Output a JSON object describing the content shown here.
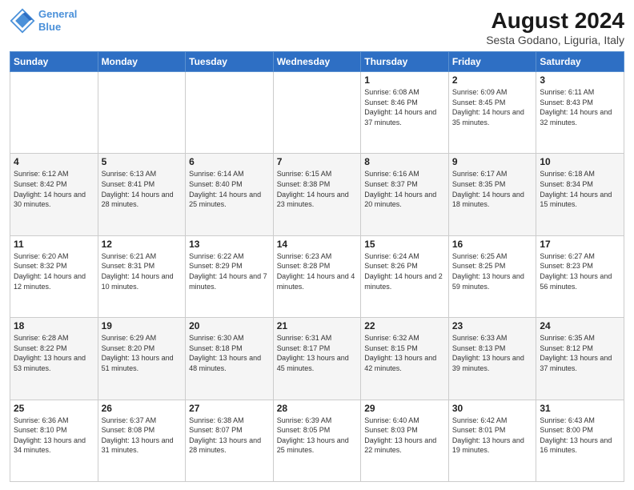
{
  "logo": {
    "line1": "General",
    "line2": "Blue"
  },
  "title": "August 2024",
  "subtitle": "Sesta Godano, Liguria, Italy",
  "days_of_week": [
    "Sunday",
    "Monday",
    "Tuesday",
    "Wednesday",
    "Thursday",
    "Friday",
    "Saturday"
  ],
  "weeks": [
    [
      {
        "day": "",
        "info": ""
      },
      {
        "day": "",
        "info": ""
      },
      {
        "day": "",
        "info": ""
      },
      {
        "day": "",
        "info": ""
      },
      {
        "day": "1",
        "info": "Sunrise: 6:08 AM\nSunset: 8:46 PM\nDaylight: 14 hours\nand 37 minutes."
      },
      {
        "day": "2",
        "info": "Sunrise: 6:09 AM\nSunset: 8:45 PM\nDaylight: 14 hours\nand 35 minutes."
      },
      {
        "day": "3",
        "info": "Sunrise: 6:11 AM\nSunset: 8:43 PM\nDaylight: 14 hours\nand 32 minutes."
      }
    ],
    [
      {
        "day": "4",
        "info": "Sunrise: 6:12 AM\nSunset: 8:42 PM\nDaylight: 14 hours\nand 30 minutes."
      },
      {
        "day": "5",
        "info": "Sunrise: 6:13 AM\nSunset: 8:41 PM\nDaylight: 14 hours\nand 28 minutes."
      },
      {
        "day": "6",
        "info": "Sunrise: 6:14 AM\nSunset: 8:40 PM\nDaylight: 14 hours\nand 25 minutes."
      },
      {
        "day": "7",
        "info": "Sunrise: 6:15 AM\nSunset: 8:38 PM\nDaylight: 14 hours\nand 23 minutes."
      },
      {
        "day": "8",
        "info": "Sunrise: 6:16 AM\nSunset: 8:37 PM\nDaylight: 14 hours\nand 20 minutes."
      },
      {
        "day": "9",
        "info": "Sunrise: 6:17 AM\nSunset: 8:35 PM\nDaylight: 14 hours\nand 18 minutes."
      },
      {
        "day": "10",
        "info": "Sunrise: 6:18 AM\nSunset: 8:34 PM\nDaylight: 14 hours\nand 15 minutes."
      }
    ],
    [
      {
        "day": "11",
        "info": "Sunrise: 6:20 AM\nSunset: 8:32 PM\nDaylight: 14 hours\nand 12 minutes."
      },
      {
        "day": "12",
        "info": "Sunrise: 6:21 AM\nSunset: 8:31 PM\nDaylight: 14 hours\nand 10 minutes."
      },
      {
        "day": "13",
        "info": "Sunrise: 6:22 AM\nSunset: 8:29 PM\nDaylight: 14 hours\nand 7 minutes."
      },
      {
        "day": "14",
        "info": "Sunrise: 6:23 AM\nSunset: 8:28 PM\nDaylight: 14 hours\nand 4 minutes."
      },
      {
        "day": "15",
        "info": "Sunrise: 6:24 AM\nSunset: 8:26 PM\nDaylight: 14 hours\nand 2 minutes."
      },
      {
        "day": "16",
        "info": "Sunrise: 6:25 AM\nSunset: 8:25 PM\nDaylight: 13 hours\nand 59 minutes."
      },
      {
        "day": "17",
        "info": "Sunrise: 6:27 AM\nSunset: 8:23 PM\nDaylight: 13 hours\nand 56 minutes."
      }
    ],
    [
      {
        "day": "18",
        "info": "Sunrise: 6:28 AM\nSunset: 8:22 PM\nDaylight: 13 hours\nand 53 minutes."
      },
      {
        "day": "19",
        "info": "Sunrise: 6:29 AM\nSunset: 8:20 PM\nDaylight: 13 hours\nand 51 minutes."
      },
      {
        "day": "20",
        "info": "Sunrise: 6:30 AM\nSunset: 8:18 PM\nDaylight: 13 hours\nand 48 minutes."
      },
      {
        "day": "21",
        "info": "Sunrise: 6:31 AM\nSunset: 8:17 PM\nDaylight: 13 hours\nand 45 minutes."
      },
      {
        "day": "22",
        "info": "Sunrise: 6:32 AM\nSunset: 8:15 PM\nDaylight: 13 hours\nand 42 minutes."
      },
      {
        "day": "23",
        "info": "Sunrise: 6:33 AM\nSunset: 8:13 PM\nDaylight: 13 hours\nand 39 minutes."
      },
      {
        "day": "24",
        "info": "Sunrise: 6:35 AM\nSunset: 8:12 PM\nDaylight: 13 hours\nand 37 minutes."
      }
    ],
    [
      {
        "day": "25",
        "info": "Sunrise: 6:36 AM\nSunset: 8:10 PM\nDaylight: 13 hours\nand 34 minutes."
      },
      {
        "day": "26",
        "info": "Sunrise: 6:37 AM\nSunset: 8:08 PM\nDaylight: 13 hours\nand 31 minutes."
      },
      {
        "day": "27",
        "info": "Sunrise: 6:38 AM\nSunset: 8:07 PM\nDaylight: 13 hours\nand 28 minutes."
      },
      {
        "day": "28",
        "info": "Sunrise: 6:39 AM\nSunset: 8:05 PM\nDaylight: 13 hours\nand 25 minutes."
      },
      {
        "day": "29",
        "info": "Sunrise: 6:40 AM\nSunset: 8:03 PM\nDaylight: 13 hours\nand 22 minutes."
      },
      {
        "day": "30",
        "info": "Sunrise: 6:42 AM\nSunset: 8:01 PM\nDaylight: 13 hours\nand 19 minutes."
      },
      {
        "day": "31",
        "info": "Sunrise: 6:43 AM\nSunset: 8:00 PM\nDaylight: 13 hours\nand 16 minutes."
      }
    ]
  ]
}
